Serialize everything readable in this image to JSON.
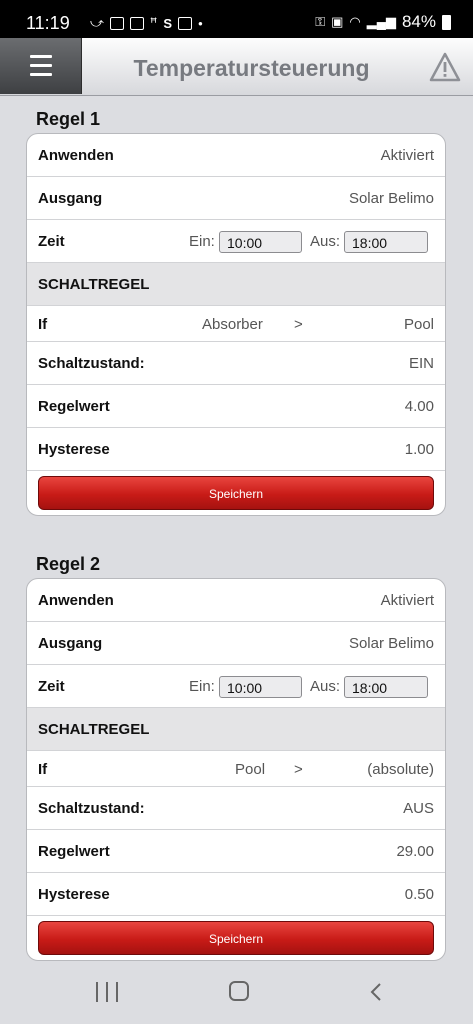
{
  "status_bar": {
    "time": "11:19",
    "left_icons": [
      "missed-call-icon",
      "mail-icon",
      "ebay-icon",
      "app-icon",
      "s-icon",
      "image-icon",
      "dot-icon"
    ],
    "battery": "84%"
  },
  "header": {
    "title": "Temperatursteuerung"
  },
  "rules": [
    {
      "title": "Regel 1",
      "anwenden_label": "Anwenden",
      "anwenden_value": "Aktiviert",
      "ausgang_label": "Ausgang",
      "ausgang_value": "Solar Belimo",
      "zeit_label": "Zeit",
      "ein_label": "Ein:",
      "ein_value": "10:00",
      "aus_label": "Aus:",
      "aus_value": "18:00",
      "section_label": "SCHALTREGEL",
      "if_label": "If",
      "if_sensor": "Absorber",
      "if_operator": ">",
      "if_target": "Pool",
      "schaltzustand_label": "Schaltzustand:",
      "schaltzustand_value": "EIN",
      "regelwert_label": "Regelwert",
      "regelwert_value": "4.00",
      "hysterese_label": "Hysterese",
      "hysterese_value": "1.00",
      "save_label": "Speichern"
    },
    {
      "title": "Regel 2",
      "anwenden_label": "Anwenden",
      "anwenden_value": "Aktiviert",
      "ausgang_label": "Ausgang",
      "ausgang_value": "Solar Belimo",
      "zeit_label": "Zeit",
      "ein_label": "Ein:",
      "ein_value": "10:00",
      "aus_label": "Aus:",
      "aus_value": "18:00",
      "section_label": "SCHALTREGEL",
      "if_label": "If",
      "if_sensor": "Pool",
      "if_operator": ">",
      "if_target": "(absolute)",
      "schaltzustand_label": "Schaltzustand:",
      "schaltzustand_value": "AUS",
      "regelwert_label": "Regelwert",
      "regelwert_value": "29.00",
      "hysterese_label": "Hysterese",
      "hysterese_value": "0.50",
      "save_label": "Speichern"
    }
  ],
  "colors": {
    "save_button": "#c81b17",
    "header_title": "#777a80",
    "background": "#dcdde1"
  }
}
